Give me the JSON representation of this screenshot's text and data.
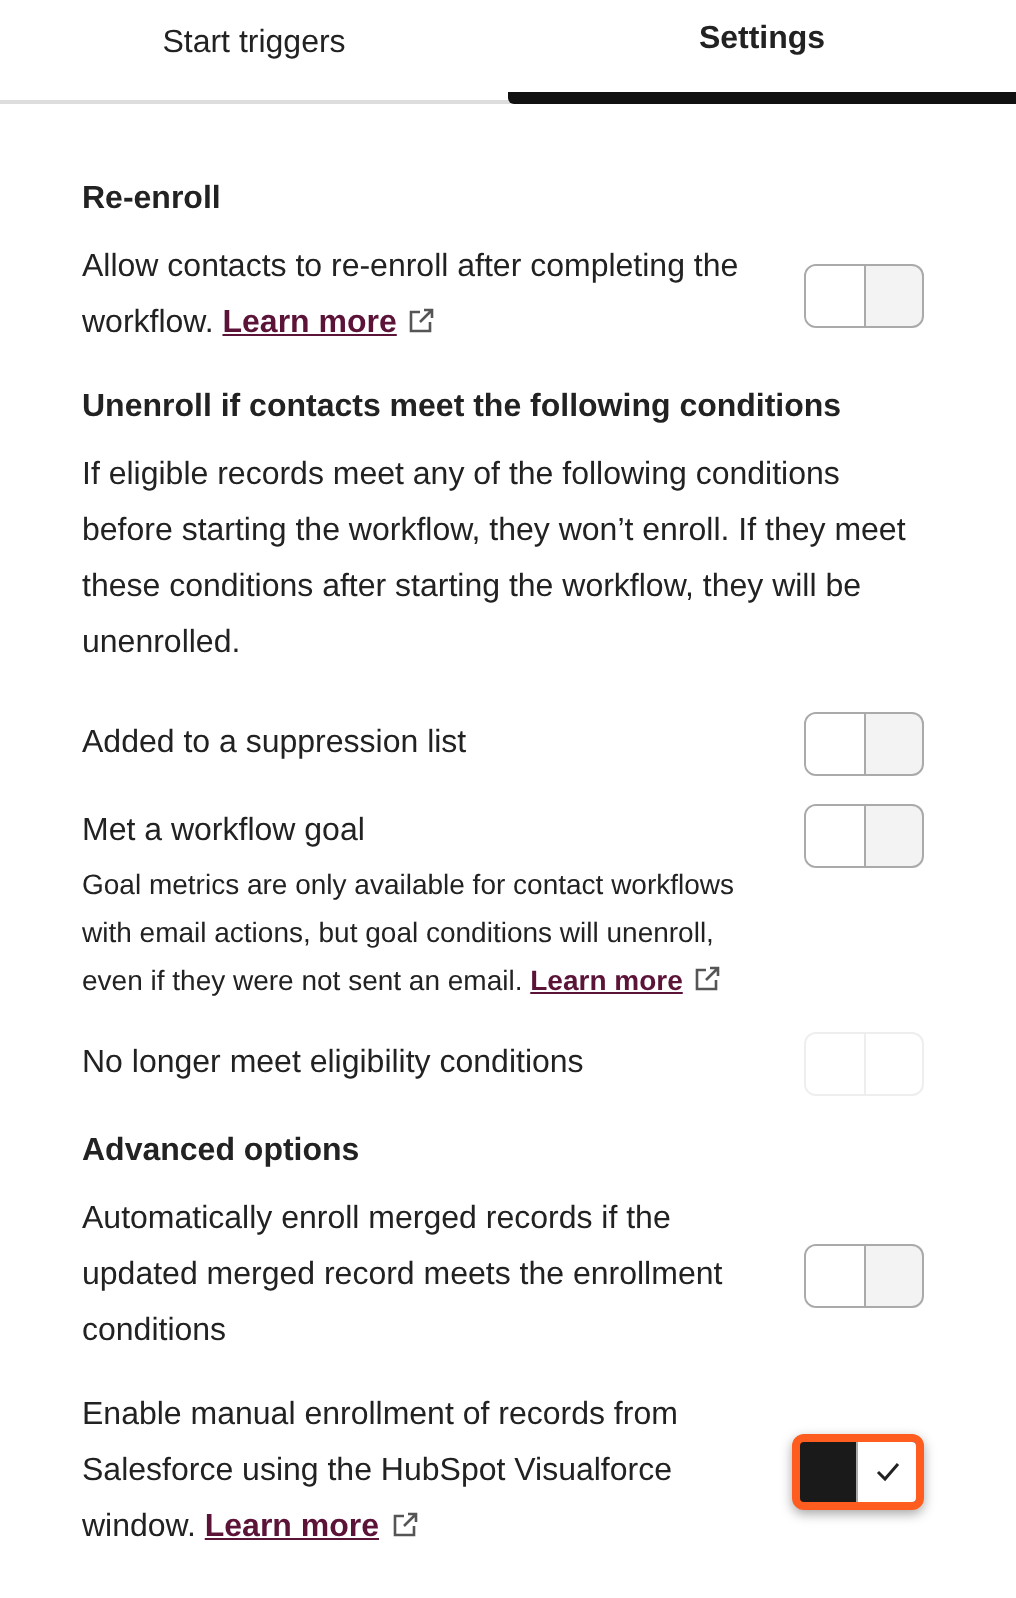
{
  "tabs": [
    {
      "label": "Start triggers",
      "selected": false
    },
    {
      "label": "Settings",
      "selected": true
    }
  ],
  "items": [
    {
      "kind": "heading",
      "text": "Re-enroll"
    },
    {
      "kind": "setting",
      "text": "Allow contacts to re-enroll after completing the workflow.",
      "link": "Learn more",
      "toggle": {
        "on": false,
        "disabled": false,
        "highlighted": false
      }
    },
    {
      "kind": "heading",
      "text": "Unenroll if contacts meet the following conditions"
    },
    {
      "kind": "paragraph",
      "text": "If eligible records meet any of the following conditions before starting the workflow, they won’t enroll. If they meet these conditions after starting the workflow, they will be unenrolled."
    },
    {
      "kind": "setting",
      "text": "Added to a suppression list",
      "toggle": {
        "on": false,
        "disabled": false,
        "highlighted": false
      }
    },
    {
      "kind": "setting",
      "text": "Met a workflow goal",
      "note": "Goal metrics are only available for contact workflows with email actions, but goal conditions will unenroll, even if they were not sent an email.",
      "note_link": "Learn more",
      "toggle": {
        "on": false,
        "disabled": false,
        "highlighted": false
      }
    },
    {
      "kind": "setting",
      "text": "No longer meet eligibility conditions",
      "toggle": {
        "on": false,
        "disabled": true,
        "highlighted": false
      }
    },
    {
      "kind": "heading",
      "text": "Advanced options"
    },
    {
      "kind": "setting",
      "text": "Automatically enroll merged records if the updated merged record meets the enrollment conditions",
      "toggle": {
        "on": false,
        "disabled": false,
        "highlighted": false
      }
    },
    {
      "kind": "setting",
      "text": "Enable manual enrollment of records from Salesforce using the HubSpot Visualforce window.",
      "link": "Learn more",
      "toggle": {
        "on": true,
        "disabled": false,
        "highlighted": true
      }
    }
  ]
}
